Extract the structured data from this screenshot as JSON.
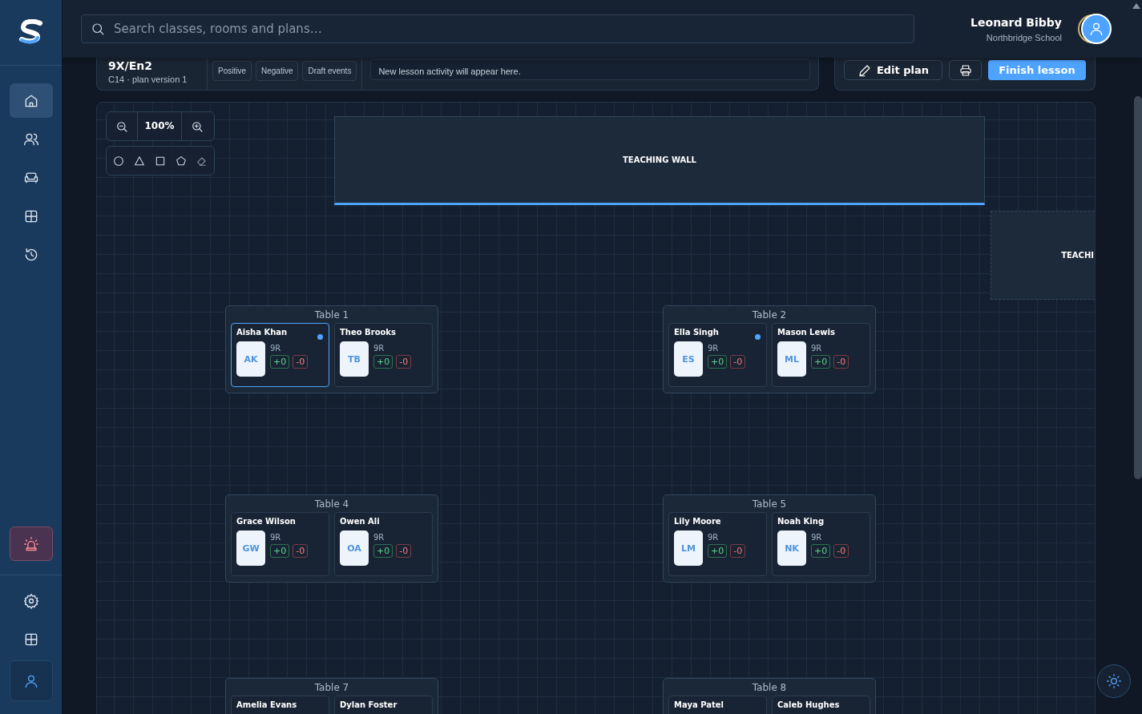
{
  "sidebar": {
    "items": [
      {
        "selected": true
      },
      {
        "selected": false
      },
      {
        "selected": false
      },
      {
        "selected": false
      },
      {
        "selected": false
      }
    ]
  },
  "search": {
    "placeholder": "Search classes, rooms and plans…"
  },
  "user": {
    "name": "Leonard Bibby",
    "school": "Northbridge School"
  },
  "lesson": {
    "class": "9X/En2",
    "subtitle": "C14 · plan version 1",
    "chips": [
      "Positive",
      "Negative",
      "Draft events"
    ],
    "activity": "New lesson activity will appear here.",
    "edit": "Edit plan",
    "finish": "Finish lesson"
  },
  "canvas": {
    "zoom": "100%",
    "walls": [
      {
        "label": "TEACHING WALL",
        "selected": true
      },
      {
        "label": "TEACHI",
        "selected": false
      }
    ],
    "tables": [
      {
        "name": "Table 1",
        "students": [
          {
            "name": "Aisha Khan",
            "initials": "AK",
            "class": "9R",
            "plus": "+0",
            "minus": "-0",
            "selected": true,
            "flagged": true
          },
          {
            "name": "Theo Brooks",
            "initials": "TB",
            "class": "9R",
            "plus": "+0",
            "minus": "-0",
            "selected": false,
            "flagged": false
          }
        ]
      },
      {
        "name": "Table 2",
        "students": [
          {
            "name": "Ella Singh",
            "initials": "ES",
            "class": "9R",
            "plus": "+0",
            "minus": "-0",
            "selected": false,
            "flagged": true
          },
          {
            "name": "Mason Lewis",
            "initials": "ML",
            "class": "9R",
            "plus": "+0",
            "minus": "-0",
            "selected": false,
            "flagged": false
          }
        ]
      },
      {
        "name": "Table 4",
        "students": [
          {
            "name": "Grace Wilson",
            "initials": "GW",
            "class": "9R",
            "plus": "+0",
            "minus": "-0",
            "selected": false,
            "flagged": false
          },
          {
            "name": "Owen Ali",
            "initials": "OA",
            "class": "9R",
            "plus": "+0",
            "minus": "-0",
            "selected": false,
            "flagged": false
          }
        ]
      },
      {
        "name": "Table 5",
        "students": [
          {
            "name": "Lily Moore",
            "initials": "LM",
            "class": "9R",
            "plus": "+0",
            "minus": "-0",
            "selected": false,
            "flagged": false
          },
          {
            "name": "Noah King",
            "initials": "NK",
            "class": "9R",
            "plus": "+0",
            "minus": "-0",
            "selected": false,
            "flagged": false
          }
        ]
      },
      {
        "name": "Table 7",
        "students": [
          {
            "name": "Amelia Evans",
            "selected": false,
            "flagged": false
          },
          {
            "name": "Dylan Foster",
            "selected": false,
            "flagged": false
          }
        ]
      },
      {
        "name": "Table 8",
        "students": [
          {
            "name": "Maya Patel",
            "selected": false,
            "flagged": false
          },
          {
            "name": "Caleb Hughes",
            "selected": false,
            "flagged": false
          }
        ]
      }
    ]
  }
}
